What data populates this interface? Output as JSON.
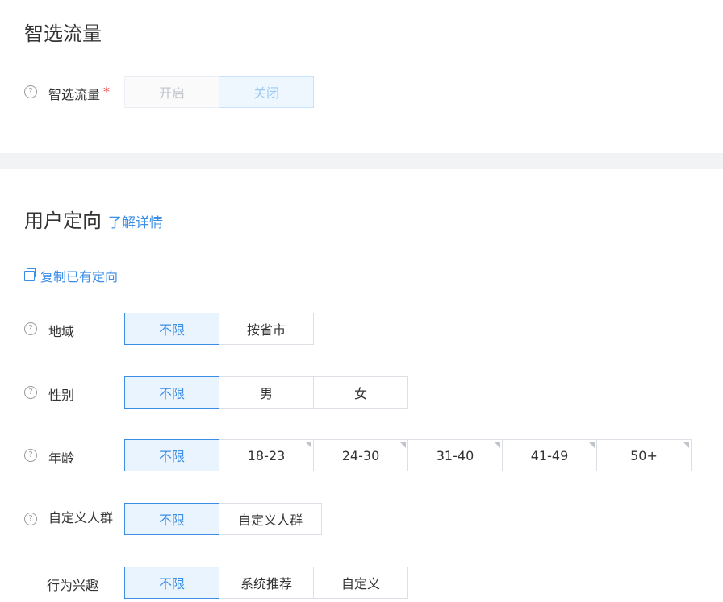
{
  "smart_traffic": {
    "title": "智选流量",
    "label": "智选流量",
    "required_mark": "*",
    "options": [
      "开启",
      "关闭"
    ],
    "selected": "关闭"
  },
  "targeting": {
    "title": "用户定向",
    "learn_more": "了解详情",
    "copy_link": "复制已有定向",
    "region": {
      "label": "地域",
      "options": [
        "不限",
        "按省市"
      ]
    },
    "gender": {
      "label": "性别",
      "options": [
        "不限",
        "男",
        "女"
      ]
    },
    "age": {
      "label": "年龄",
      "options": [
        "不限",
        "18-23",
        "24-30",
        "31-40",
        "41-49",
        "50+"
      ]
    },
    "custom_audience": {
      "label": "自定义人群",
      "options": [
        "不限",
        "自定义人群"
      ]
    },
    "behavior_interest": {
      "label": "行为兴趣",
      "options": [
        "不限",
        "系统推荐",
        "自定义"
      ]
    }
  },
  "icons": {
    "help": "help-circle-icon",
    "copy": "copy-icon"
  },
  "colors": {
    "accent": "#3a8ee6",
    "required": "#e84b4b"
  }
}
